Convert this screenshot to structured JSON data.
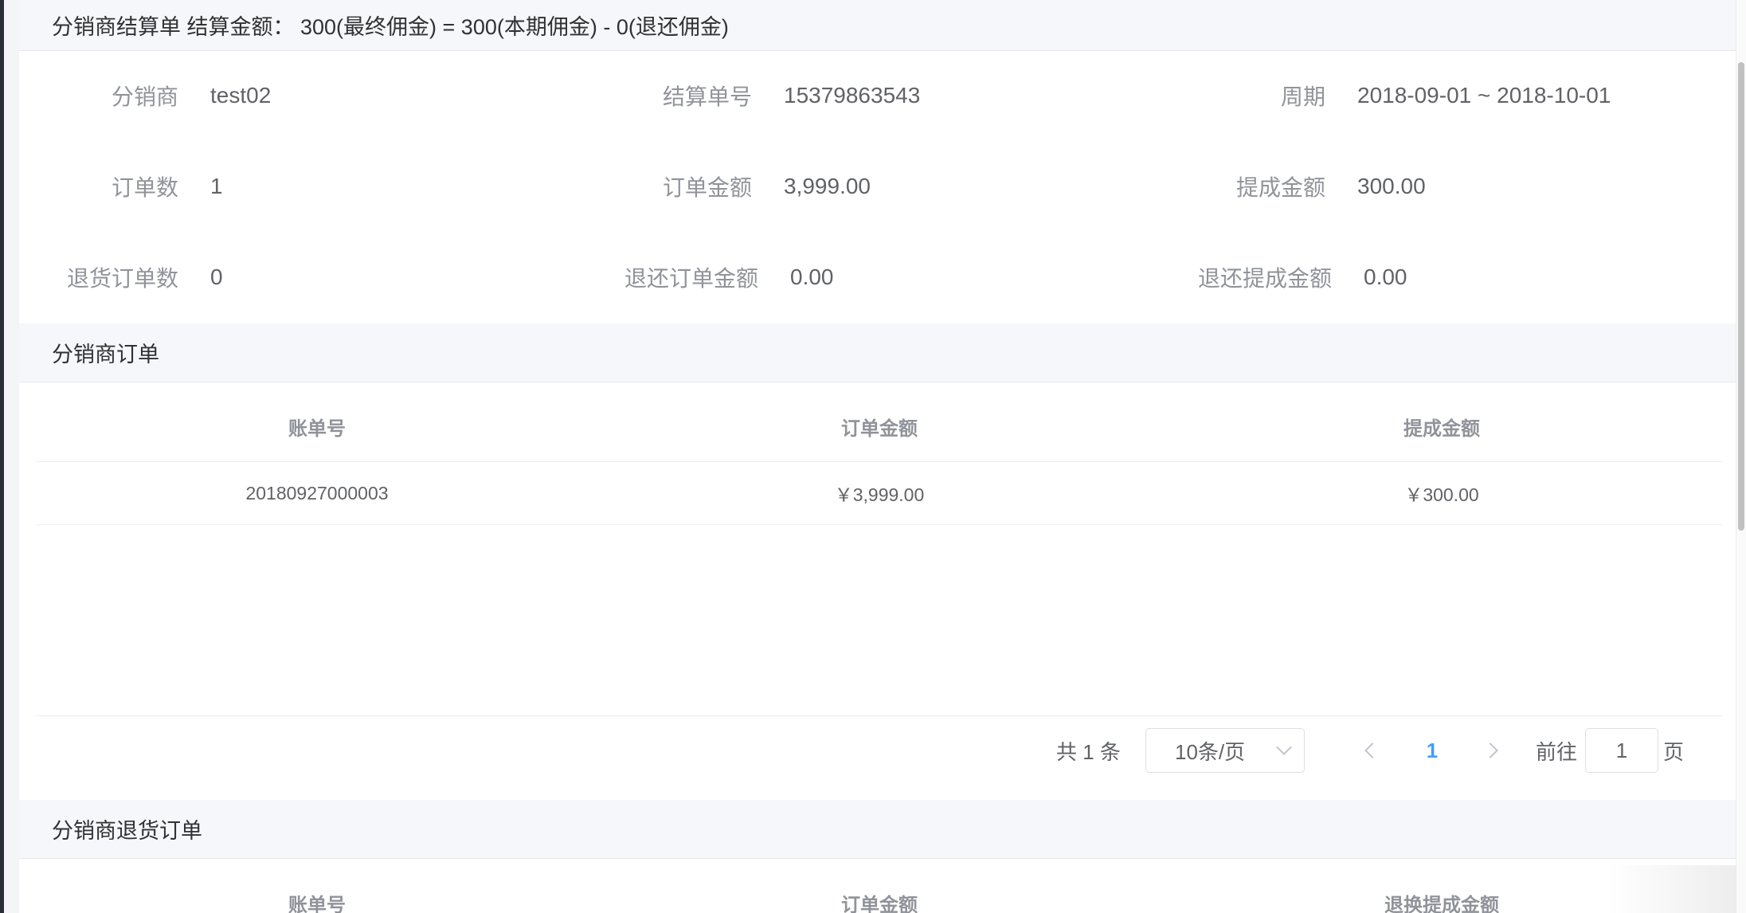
{
  "settlement": {
    "title": "分销商结算单 结算金额： 300(最终佣金) = 300(本期佣金) - 0(退还佣金)",
    "fields": [
      {
        "label": "分销商",
        "value": "test02"
      },
      {
        "label": "结算单号",
        "value": "15379863543"
      },
      {
        "label": "周期",
        "value": "2018-09-01 ~ 2018-10-01"
      },
      {
        "label": "订单数",
        "value": "1"
      },
      {
        "label": "订单金额",
        "value": "3,999.00"
      },
      {
        "label": "提成金额",
        "value": "300.00"
      },
      {
        "label": "退货订单数",
        "value": "0"
      },
      {
        "label": "退还订单金额",
        "value": "0.00"
      },
      {
        "label": "退还提成金额",
        "value": "0.00"
      }
    ]
  },
  "orders": {
    "title": "分销商订单",
    "columns": [
      "账单号",
      "订单金额",
      "提成金额"
    ],
    "rows": [
      [
        "20180927000003",
        "￥3,999.00",
        "￥300.00"
      ]
    ],
    "pagination": {
      "total_label": "共 1 条",
      "page_size": "10条/页",
      "current_page": "1",
      "goto_label": "前往",
      "goto_value": "1",
      "goto_suffix": "页"
    }
  },
  "returns": {
    "title": "分销商退货订单",
    "columns": [
      "账单号",
      "订单金额",
      "退换提成金额"
    ]
  },
  "icons": {
    "prev": "chevron-left-icon",
    "next": "chevron-right-icon",
    "select": "chevron-down-icon"
  },
  "colors": {
    "accent": "#409eff",
    "header_bg": "#f5f7fa",
    "label": "#909399",
    "text": "#606266"
  }
}
